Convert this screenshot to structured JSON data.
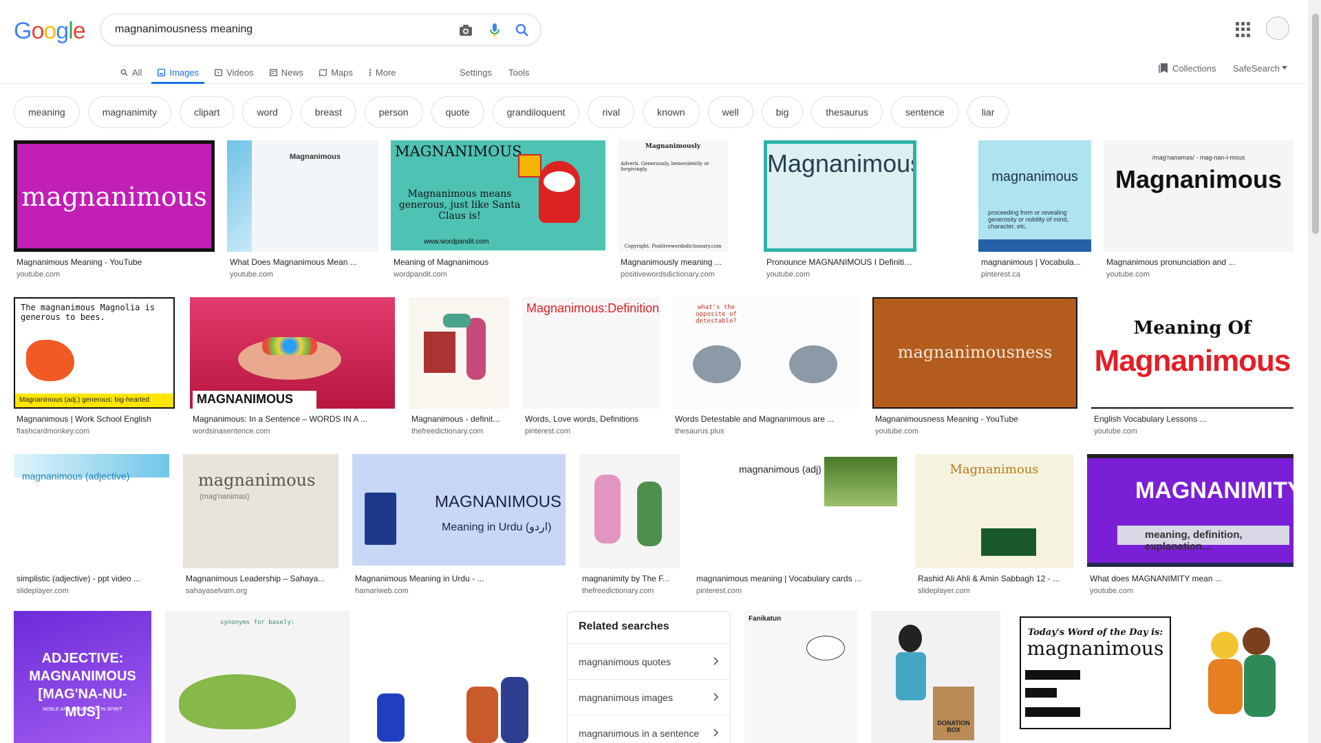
{
  "logo": [
    "G",
    "o",
    "o",
    "g",
    "l",
    "e"
  ],
  "logo_colors": [
    "#4285F4",
    "#EA4335",
    "#FBBC05",
    "#4285F4",
    "#34A853",
    "#EA4335"
  ],
  "search": {
    "query": "magnanimousness meaning"
  },
  "tabs": [
    {
      "label": "All",
      "icon": "search-icon"
    },
    {
      "label": "Images",
      "icon": "image-icon",
      "active": true
    },
    {
      "label": "Videos",
      "icon": "video-icon"
    },
    {
      "label": "News",
      "icon": "news-icon"
    },
    {
      "label": "Maps",
      "icon": "map-icon"
    },
    {
      "label": "More",
      "icon": "more-vert-icon"
    }
  ],
  "tools": {
    "settings": "Settings",
    "tools": "Tools",
    "collections": "Collections",
    "safesearch": "SafeSearch"
  },
  "chips": [
    "meaning",
    "magnanimity",
    "clipart",
    "word",
    "breast",
    "person",
    "quote",
    "grandiloquent",
    "rival",
    "known",
    "well",
    "big",
    "thesaurus",
    "sentence",
    "liar"
  ],
  "results": [
    {
      "title": "Magnanimous Meaning - YouTube",
      "source": "youtube.com",
      "text": "magnanimous"
    },
    {
      "title": "What Does Magnanimous Mean ...",
      "source": "youtube.com",
      "text": "Magnanimous"
    },
    {
      "title": "Meaning of Magnanimous",
      "source": "wordpandit.com",
      "text": "MAGNANIMOUS",
      "sub": "Magnanimous means generous, just like Santa Claus is!",
      "foot": "www.wordpandit.com"
    },
    {
      "title": "Magnanimously meaning ...",
      "source": "positivewordsdictionary.com",
      "text": "Magnanimously",
      "sub": "Adverb. Generously, benevolently or forgivingly.",
      "foot": "Copyright. Positivewordsdictionary.com"
    },
    {
      "title": "Pronounce MAGNANIMOUS I Definition ...",
      "source": "youtube.com",
      "text": "Magnanimous"
    },
    {
      "title": "magnanimous | Vocabula...",
      "source": "pinterest.ca",
      "text": "magnanimous",
      "sub": "proceeding from or revealing generosity or nobility of mind, character, etc."
    },
    {
      "title": "Magnanimous pronunciation and ...",
      "source": "youtube.com",
      "text": "Magnanimous",
      "sub": "/mag'nanəməs/ - mag-nan-i-mous"
    },
    {
      "title": "Magnanimous | Work School English",
      "source": "flashcardmonkey.com",
      "text": "The magnanimous Magnolia is generous to bees.",
      "sub": "Magnanimous (adj.) generous; big-hearted"
    },
    {
      "title": "Magnanimous: In a Sentence – WORDS IN A ...",
      "source": "wordsinasentence.com",
      "text": "MAGNANIMOUS"
    },
    {
      "title": "Magnanimous - definit...",
      "source": "thefreedictionary.com"
    },
    {
      "title": "Words, Love words, Definitions",
      "source": "pinterest.com",
      "text": "Magnanimous:Definition"
    },
    {
      "title": "Words Detestable and Magnanimous are ...",
      "source": "thesaurus.plus",
      "text": "what's the opposite of detestable?"
    },
    {
      "title": "Magnanimousness Meaning - YouTube",
      "source": "youtube.com",
      "text": "magnanimousness"
    },
    {
      "title": "English Vocabulary Lessons ...",
      "source": "youtube.com",
      "text": "Meaning Of",
      "sub": "Magnanimous"
    },
    {
      "title": "simplistic (adjective) - ppt video ...",
      "source": "slideplayer.com",
      "text": "magnanimous (adjective)"
    },
    {
      "title": "Magnanimous Leadership – Sahaya...",
      "source": "sahayaselvam.org",
      "text": "magnanimous",
      "sub": "(mag'nanimas)"
    },
    {
      "title": "Magnanimous Meaning in Urdu - ...",
      "source": "hamariweb.com",
      "text": "MAGNANIMOUS",
      "sub": "Meaning in Urdu (اردو)"
    },
    {
      "title": "magnanimity by The F...",
      "source": "thefreedictionary.com"
    },
    {
      "title": "magnanimous meaning | Vocabulary cards ...",
      "source": "pinterest.com",
      "text": "magnanimous (adj)"
    },
    {
      "title": "Rashid Ali Ahli & Amin Sabbagh 12 - ...",
      "source": "slideplayer.com",
      "text": "Magnanimous"
    },
    {
      "title": "What does MAGNANIMITY mean ...",
      "source": "youtube.com",
      "text": "MAGNANIMITY",
      "sub": "meaning, definition, explanation..."
    },
    {
      "text": "ADJECTIVE: MAGNANIMOUS [MAG'NA-NU-MUS]",
      "sub": "NOBLE AND GENEROUS IN SPIRIT"
    },
    {
      "text": "synonyms for basely:"
    },
    {
      "text": ""
    },
    {
      "text": "Fanikatun"
    },
    {
      "text": "DONATION BOX"
    },
    {
      "text": "Today's Word of the Day is:",
      "sub": "magnanimous"
    },
    {
      "text": ""
    }
  ],
  "related": {
    "title": "Related searches",
    "items": [
      "magnanimous quotes",
      "magnanimous images",
      "magnanimous in a sentence"
    ]
  },
  "colors": {
    "accent": "#1a73e8",
    "magenta": "#c21fb5",
    "orange": "#b35c1e",
    "purple": "#7a1fd6",
    "red": "#e41e26"
  }
}
